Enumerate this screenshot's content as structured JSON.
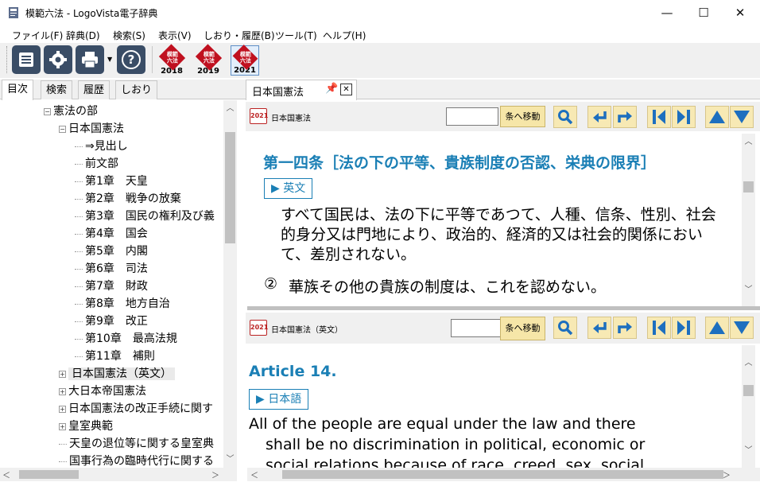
{
  "window": {
    "title": "模範六法 - LogoVista電子辞典",
    "minimize": "—",
    "maximize": "☐",
    "close": "✕"
  },
  "menu": [
    "ファイル(F)",
    "辞典(D)",
    "検索(S)",
    "表示(V)",
    "しおり・履歴(B)",
    "ツール(T)",
    "ヘルプ(H)"
  ],
  "toolbar": {
    "help_glyph": "?",
    "editions": [
      {
        "badge": "模範\n六法",
        "year": "2018"
      },
      {
        "badge": "模範\n六法",
        "year": "2019"
      },
      {
        "badge": "模範\n六法",
        "year": "2021"
      }
    ]
  },
  "left_tabs": [
    "目次",
    "検索",
    "履歴",
    "しおり"
  ],
  "tree": [
    {
      "label": "憲法の部",
      "level": 0,
      "expander": "−"
    },
    {
      "label": "日本国憲法",
      "level": 1,
      "expander": "−"
    },
    {
      "label": "⇒見出し",
      "level": 2
    },
    {
      "label": "前文部",
      "level": 2
    },
    {
      "label": "第1章　天皇",
      "level": 2
    },
    {
      "label": "第2章　戦争の放棄",
      "level": 2
    },
    {
      "label": "第3章　国民の権利及び義",
      "level": 2
    },
    {
      "label": "第4章　国会",
      "level": 2
    },
    {
      "label": "第5章　内閣",
      "level": 2
    },
    {
      "label": "第6章　司法",
      "level": 2
    },
    {
      "label": "第7章　財政",
      "level": 2
    },
    {
      "label": "第8章　地方自治",
      "level": 2
    },
    {
      "label": "第9章　改正",
      "level": 2
    },
    {
      "label": "第10章　最高法規",
      "level": 2
    },
    {
      "label": "第11章　補則",
      "level": 2
    },
    {
      "label": "日本国憲法（英文）",
      "level": 1,
      "expander": "+",
      "selected": true
    },
    {
      "label": "大日本帝国憲法",
      "level": 1,
      "expander": "+"
    },
    {
      "label": "日本国憲法の改正手続に関す",
      "level": 1,
      "expander": "+"
    },
    {
      "label": "皇室典範",
      "level": 1,
      "expander": "+"
    },
    {
      "label": "天皇の退位等に関する皇室典",
      "level": 1
    },
    {
      "label": "国事行為の臨時代行に関する",
      "level": 1
    }
  ],
  "doc_tab": {
    "label": "日本国憲法",
    "close": "✕"
  },
  "pane_top": {
    "book_year": "2021",
    "book_title": "日本国憲法",
    "jump_label": "条へ移動",
    "article_heading": "第一四条［法の下の平等、貴族制度の否認、栄典の限界］",
    "toggle_label": "▶ 英文",
    "para1": "すべて国民は、法の下に平等であつて、人種、信条、性別、社会的身分又は門地により、政治的、経済的又は社会的関係において、差別されない。",
    "para2_num": "②",
    "para2": "華族その他の貴族の制度は、これを認めない。"
  },
  "pane_bottom": {
    "book_year": "2021",
    "book_title": "日本国憲法（英文）",
    "jump_label": "条へ移動",
    "article_heading": "Article 14.",
    "toggle_label": "▶ 日本語",
    "para_line1": "All of the people are equal under the law and there",
    "para_line2": "shall be no discrimination in political, economic or",
    "para_line3": "social relations because of race, creed, sex, social"
  },
  "colors": {
    "accent_heading": "#1a7fb5",
    "toolbar_icon": "#3a4d66",
    "nav_button": "#f7e9b4",
    "nav_arrow": "#1d6fbf",
    "edition_red": "#c0101f"
  }
}
